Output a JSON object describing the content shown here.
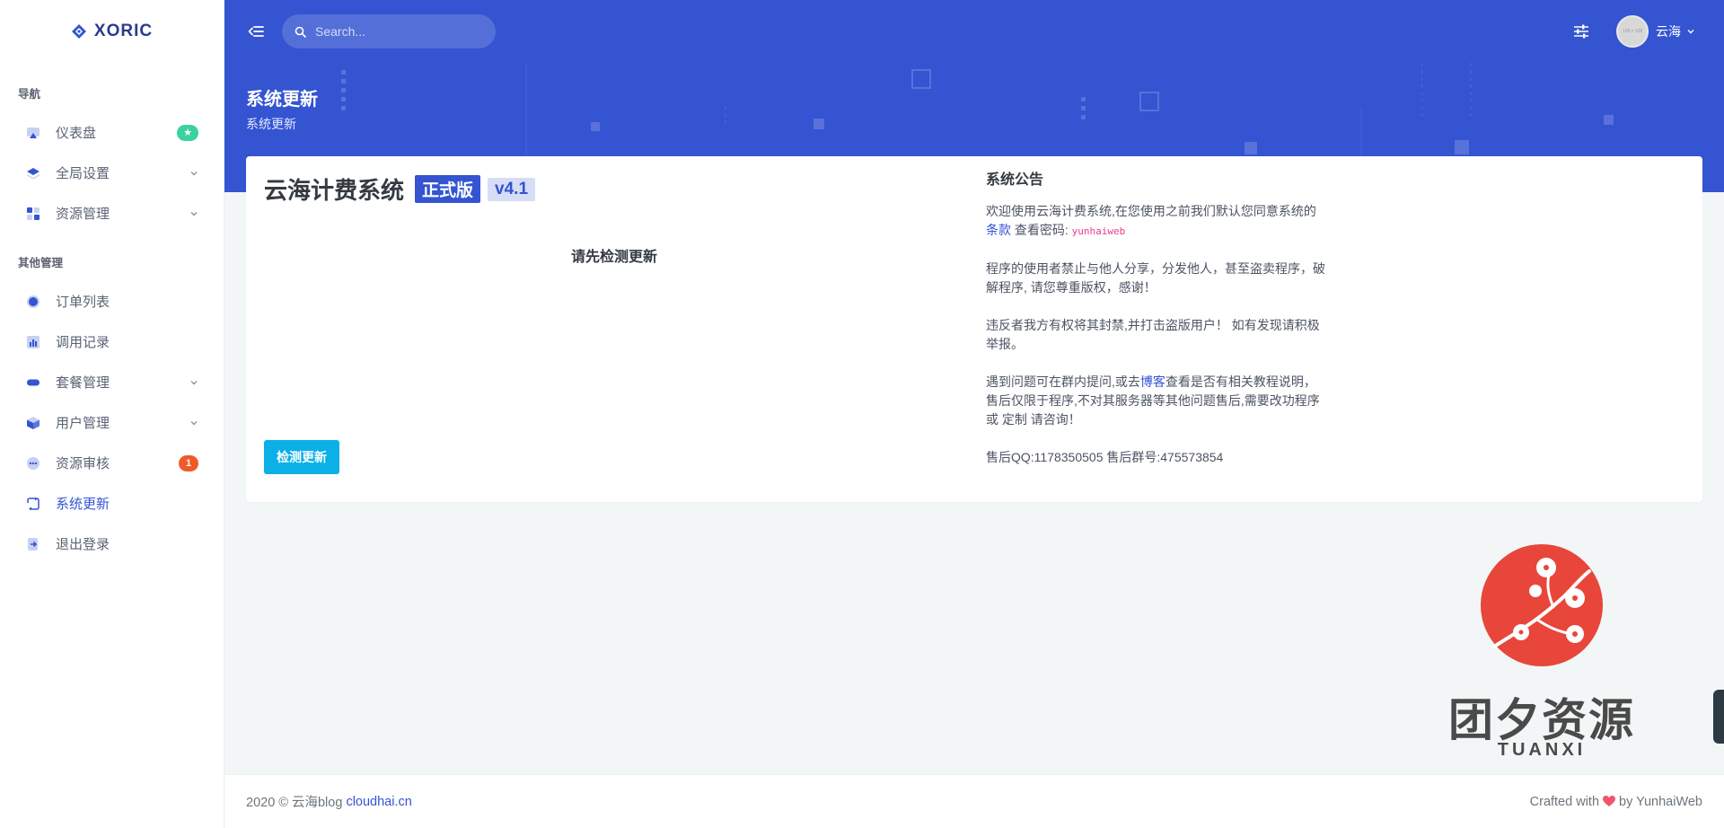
{
  "brand": {
    "name": "XORIC"
  },
  "sidebar": {
    "section1": "导航",
    "section2": "其他管理",
    "items": [
      {
        "label": "仪表盘",
        "icon": "monitor-icon",
        "badge": "★"
      },
      {
        "label": "全局设置",
        "icon": "layers-icon",
        "expandable": true
      },
      {
        "label": "资源管理",
        "icon": "grid-icon",
        "expandable": true
      },
      {
        "label": "订单列表",
        "icon": "circle-icon"
      },
      {
        "label": "调用记录",
        "icon": "bar-chart-icon"
      },
      {
        "label": "套餐管理",
        "icon": "pill-icon",
        "expandable": true
      },
      {
        "label": "用户管理",
        "icon": "cube-icon",
        "expandable": true
      },
      {
        "label": "资源审核",
        "icon": "chat-bubble-icon",
        "badge": "1"
      },
      {
        "label": "系统更新",
        "icon": "refresh-icon",
        "active": true
      },
      {
        "label": "退出登录",
        "icon": "logout-icon"
      }
    ]
  },
  "topbar": {
    "search_placeholder": "Search...",
    "avatar_text": "128 × 128",
    "user_name": "云海"
  },
  "hero": {
    "title": "系统更新",
    "subtitle": "系统更新"
  },
  "card": {
    "app_name": "云海计费系统",
    "release_tag": "正式版",
    "version": "v4.1",
    "check_hint": "请先检测更新",
    "check_button": "检测更新"
  },
  "notice": {
    "title": "系统公告",
    "p1_a": "欢迎使用云海计费系统,在您使用之前我们默认您同意系统的",
    "p1_link": "条款",
    "p1_b": "查看密码:",
    "p1_code": "yunhaiweb",
    "p2": "程序的使用者禁止与他人分享，分发他人，甚至盗卖程序，破解程序, 请您尊重版权，感谢！",
    "p3": "违反者我方有权将其封禁,并打击盗版用户！ 如有发现请积极举报。",
    "p4_a": "遇到问题可在群内提问,或去",
    "p4_link": "博客",
    "p4_b": "查看是否有相关教程说明，售后仅限于程序,不对其服务器等其他问题售后,需要改功程序 或 定制 请咨询！",
    "p5": "售后QQ:1178350505 售后群号:475573854"
  },
  "watermark": {
    "text": "团夕资源",
    "sub": "TUANXI"
  },
  "footer": {
    "left_text": "2020 © 云海blog",
    "left_link": "cloudhai.cn",
    "right_a": "Crafted with",
    "right_b": "by YunhaiWeb"
  },
  "colors": {
    "primary": "#3454d1",
    "info": "#0ab0e6",
    "success": "#3ad29f",
    "danger": "#f05a28",
    "heart": "#f1556c",
    "watermark_red": "#e8463a"
  }
}
